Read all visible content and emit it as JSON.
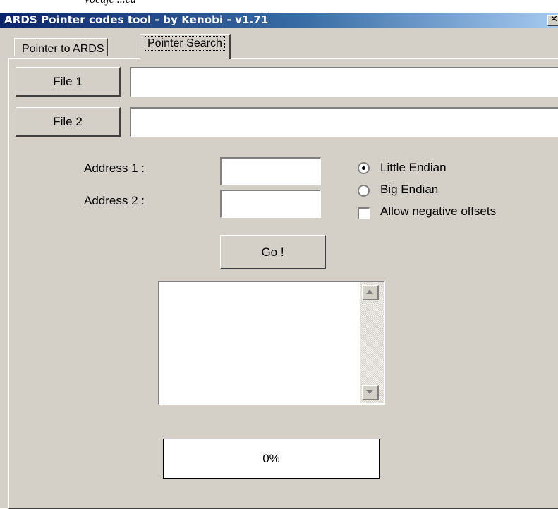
{
  "background_text": "vocajc ...ca",
  "window": {
    "title": "ARDS Pointer codes tool - by Kenobi - v1.71",
    "close_glyph": "✕"
  },
  "tabs": [
    {
      "label": "Pointer to ARDS",
      "active": false
    },
    {
      "label": "Pointer Search",
      "active": true
    }
  ],
  "file1": {
    "button_label": "File 1",
    "value": ""
  },
  "file2": {
    "button_label": "File 2",
    "value": ""
  },
  "address1": {
    "label": "Address 1 :",
    "value": ""
  },
  "address2": {
    "label": "Address 2 :",
    "value": ""
  },
  "endian": {
    "little": {
      "label": "Little Endian",
      "selected": true
    },
    "big": {
      "label": "Big Endian",
      "selected": false
    }
  },
  "negative_offsets": {
    "label": "Allow negative offsets",
    "checked": false
  },
  "go_button": {
    "label": "Go !"
  },
  "results_list": {
    "items": []
  },
  "progress": {
    "value": 0,
    "label": "0%"
  },
  "colors": {
    "titlebar_start": "#0a246a",
    "titlebar_end": "#a6caf0",
    "face": "#d4d0c8"
  }
}
